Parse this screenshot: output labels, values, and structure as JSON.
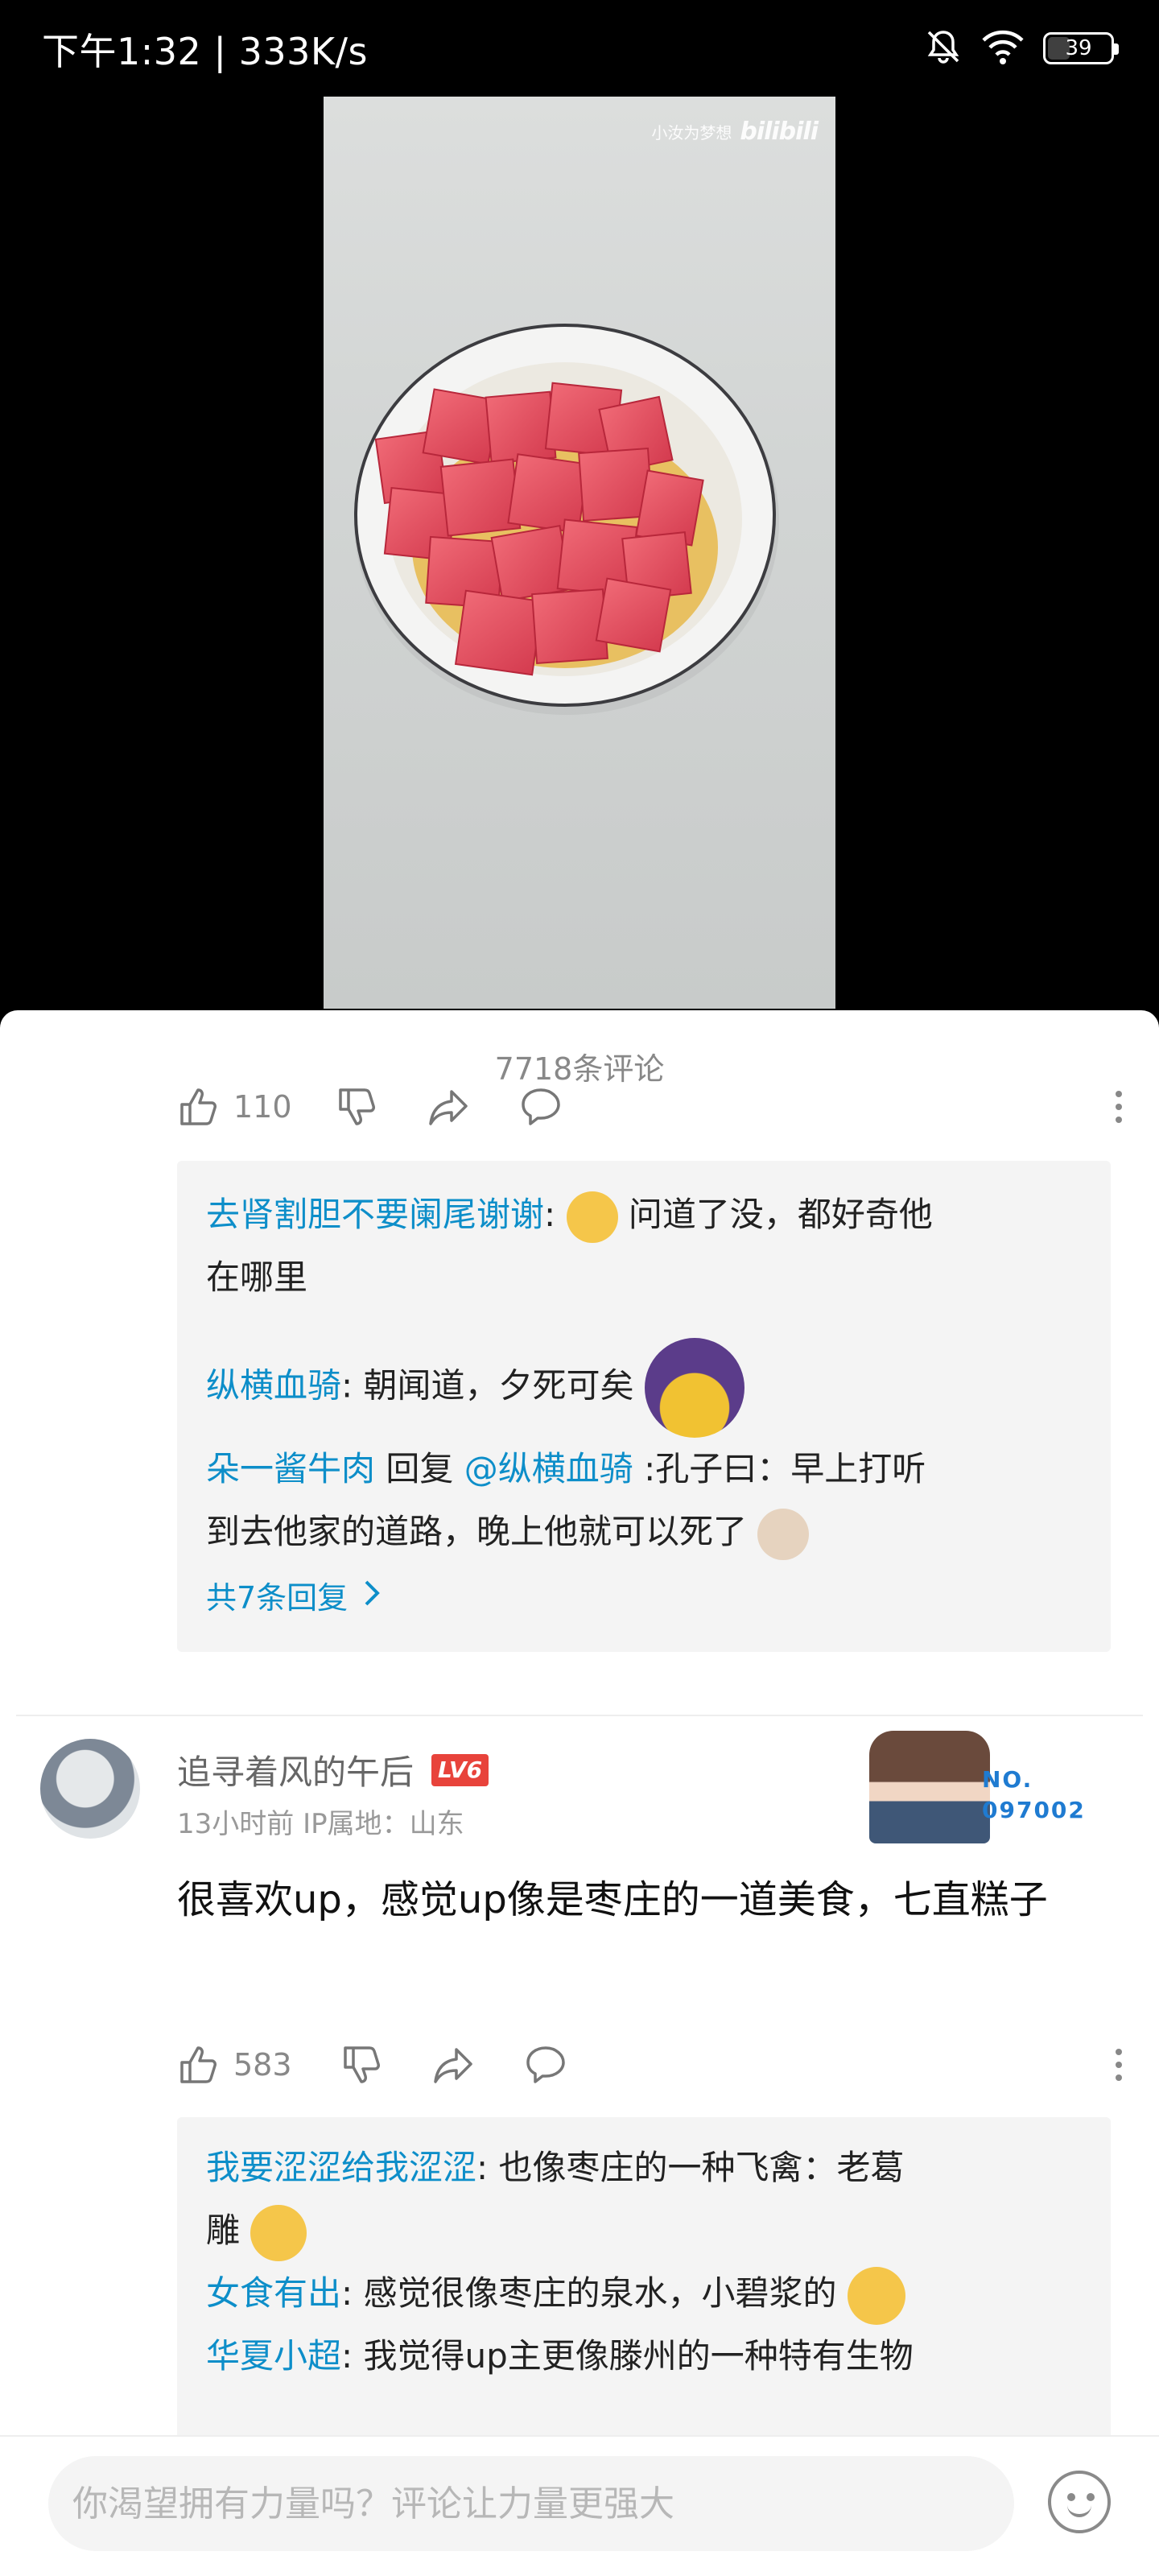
{
  "status": {
    "time": "下午1:32",
    "separator": "|",
    "net_speed": "333K/s",
    "battery": "39"
  },
  "video": {
    "watermark_text": "小汝为梦想",
    "watermark_logo": "bilibili"
  },
  "comments": {
    "count_title": "7718条评论",
    "first": {
      "like_count": "110",
      "replies": [
        {
          "user": "去肾割胆不要阑尾谢谢",
          "sep": ":",
          "text_a": "问道了没，都好奇他",
          "text_b": "在哪里"
        },
        {
          "user": "纵横血骑",
          "sep": ":",
          "text": "朝闻道，夕死可矣"
        },
        {
          "user": "朵一酱牛肉",
          "reply_word": "回复",
          "mention": "@纵横血骑",
          "text_a": ":孔子曰：早上打听",
          "text_b": "到去他家的道路，晚上他就可以死了"
        }
      ],
      "more_replies": "共7条回复"
    },
    "second": {
      "username": "追寻着风的午后",
      "level": "LV6",
      "meta": "13小时前  IP属地：山东",
      "fan_badge_line1": "NO.",
      "fan_badge_line2": "097002",
      "text": "很喜欢up，感觉up像是枣庄的一道美食，七直糕子",
      "like_count": "583",
      "replies": [
        {
          "user": "我要涩涩给我涩涩",
          "sep": ":",
          "text_a": "也像枣庄的一种飞禽：老葛",
          "text_b": "雕"
        },
        {
          "user": "女食有出",
          "sep": ":",
          "text": "感觉很像枣庄的泉水，小碧浆的"
        },
        {
          "user": "华夏小超",
          "sep": ":",
          "text": "我觉得up主更像滕州的一种特有生物"
        }
      ]
    }
  },
  "input": {
    "placeholder": "你渴望拥有力量吗？评论让力量更强大"
  },
  "colors": {
    "link_blue": "#0d8ec9",
    "level_red": "#e8433b",
    "fan_no_blue": "#1f7bd1"
  },
  "icons": [
    "mute-bell-icon",
    "wifi-icon",
    "battery-icon",
    "thumb-up-icon",
    "thumb-down-icon",
    "share-icon",
    "reply-bubble-icon",
    "more-vertical-icon",
    "chevron-right-icon",
    "emoji-face-icon"
  ]
}
